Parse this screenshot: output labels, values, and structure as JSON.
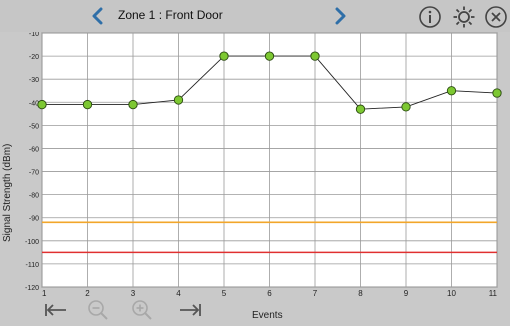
{
  "header": {
    "title": "Zone 1 :  Front Door",
    "prev_icon": "chevron-left-icon",
    "next_icon": "chevron-right-icon",
    "info_icon": "info-icon",
    "settings_icon": "gear-icon",
    "close_icon": "close-icon",
    "accent": "#2f6fa8"
  },
  "footer": {
    "first_icon": "jump-first-icon",
    "zoom_out_icon": "zoom-out-icon",
    "zoom_in_icon": "zoom-in-icon",
    "last_icon": "jump-last-icon"
  },
  "chart_data": {
    "type": "line",
    "xlabel": "Events",
    "ylabel": "Signal Strength (dBm)",
    "x": [
      1,
      2,
      3,
      4,
      5,
      6,
      7,
      8,
      9,
      10,
      11
    ],
    "xticks": [
      "1",
      "2",
      "3",
      "4",
      "5",
      "6",
      "7",
      "8",
      "9",
      "10",
      "11"
    ],
    "yticks": [
      "-10",
      "-20",
      "-30",
      "-40",
      "-50",
      "-60",
      "-70",
      "-80",
      "-90",
      "-100",
      "-110",
      "-120"
    ],
    "ylim": [
      -120,
      -10
    ],
    "xlim": [
      1,
      11
    ],
    "grid": true,
    "series": [
      {
        "values": [
          -41,
          -41,
          -41,
          -39,
          -20,
          -20,
          -20,
          -43,
          -42,
          -35,
          -36
        ],
        "color": "#222222",
        "marker_color": "#7dc832"
      }
    ],
    "reference_lines": [
      {
        "y": -92,
        "color": "#f2a62a"
      },
      {
        "y": -105,
        "color": "#e03030"
      }
    ]
  }
}
